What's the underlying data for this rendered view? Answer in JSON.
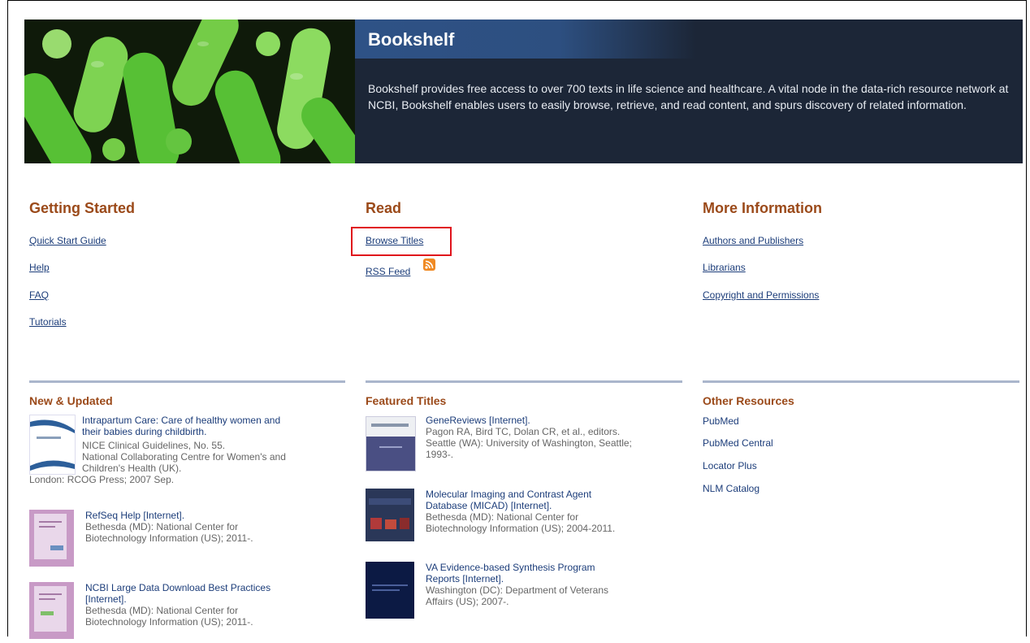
{
  "banner": {
    "title": "Bookshelf",
    "description": "Bookshelf provides free access to over 700 texts in life science and healthcare. A vital node in the data-rich resource network at NCBI, Bookshelf enables users to easily browse, retrieve, and read content, and spurs discovery of related information."
  },
  "getting_started": {
    "heading": "Getting Started",
    "links": [
      "Quick Start Guide",
      "Help",
      "FAQ",
      "Tutorials"
    ]
  },
  "read": {
    "heading": "Read",
    "links": [
      "Browse Titles",
      "RSS Feed"
    ]
  },
  "more_info": {
    "heading": "More Information",
    "links": [
      "Authors and Publishers",
      "Librarians",
      "Copyright and Permissions"
    ]
  },
  "new_updated": {
    "heading": "New & Updated",
    "items": [
      {
        "title1": "Intrapartum Care: Care of healthy women and",
        "title2": "their babies during childbirth.",
        "meta": [
          "NICE Clinical Guidelines, No. 55.",
          "National Collaborating Centre for Women's and",
          "Children's Health (UK).",
          "London: RCOG Press; 2007 Sep."
        ]
      },
      {
        "title1": "RefSeq Help [Internet].",
        "meta": [
          "Bethesda (MD): National Center for",
          "Biotechnology Information (US); 2011-."
        ]
      },
      {
        "title1": "NCBI Large Data Download Best Practices",
        "title2": "[Internet].",
        "meta": [
          "Bethesda (MD): National Center for",
          "Biotechnology Information (US); 2011-."
        ]
      }
    ]
  },
  "featured": {
    "heading": "Featured Titles",
    "items": [
      {
        "title1": "GeneReviews [Internet].",
        "meta": [
          "Pagon RA, Bird TC, Dolan CR, et al., editors.",
          "Seattle (WA): University of Washington, Seattle;",
          "1993-."
        ]
      },
      {
        "title1": "Molecular Imaging and Contrast Agent",
        "title2": "Database (MICAD) [Internet].",
        "meta": [
          "Bethesda (MD): National Center for",
          "Biotechnology Information (US); 2004-2011."
        ]
      },
      {
        "title1": "VA Evidence-based Synthesis Program",
        "title2": "Reports [Internet].",
        "meta": [
          "Washington (DC): Department of Veterans",
          "Affairs (US); 2007-."
        ]
      }
    ]
  },
  "other_resources": {
    "heading": "Other Resources",
    "links": [
      "PubMed",
      "PubMed Central",
      "Locator Plus",
      "NLM Catalog"
    ]
  },
  "colors": {
    "heading": "#9b4a1a",
    "link": "#1c3d7a",
    "banner_bg": "#1c2637",
    "highlight": "#e0141c"
  }
}
